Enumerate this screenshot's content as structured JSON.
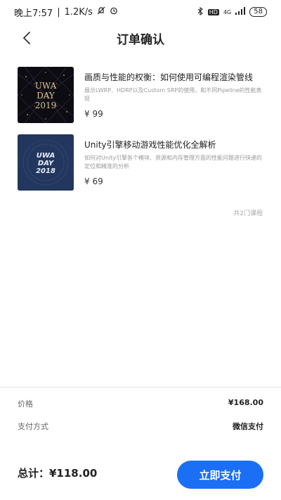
{
  "statusbar": {
    "time": "晚上7:57",
    "network_speed": "1.2K/s",
    "signal_label": "4G",
    "battery": "58"
  },
  "header": {
    "title": "订单确认"
  },
  "courses": [
    {
      "title": "画质与性能的权衡：如何使用可编程渲染管线",
      "description": "展示LWRP、HDRP以及Custom SRP的使用，和不同Pipeline的性能表现",
      "price": "¥ 99",
      "thumb_line1": "UWA",
      "thumb_line2": "DAY",
      "thumb_line3": "2019"
    },
    {
      "title": "Unity引擎移动游戏性能优化全解析",
      "description": "如何对Unity引擎各个模块、资源和内存管理方面的性能问题进行快速的定位和精准的分析",
      "price": "¥ 69",
      "thumb_line1": "UWA",
      "thumb_line2": "DAY",
      "thumb_line3": "2018"
    }
  ],
  "course_count": "共2门课程",
  "summary": {
    "price_label": "价格",
    "price_value": "¥168.00",
    "payment_label": "支付方式",
    "payment_value": "微信支付",
    "total": "总计：¥118.00",
    "pay_button": "立即支付"
  },
  "colors": {
    "accent": "#1a6ff5",
    "thumb1_bg": "#0c0c12",
    "thumb2_bg": "#23375e"
  }
}
